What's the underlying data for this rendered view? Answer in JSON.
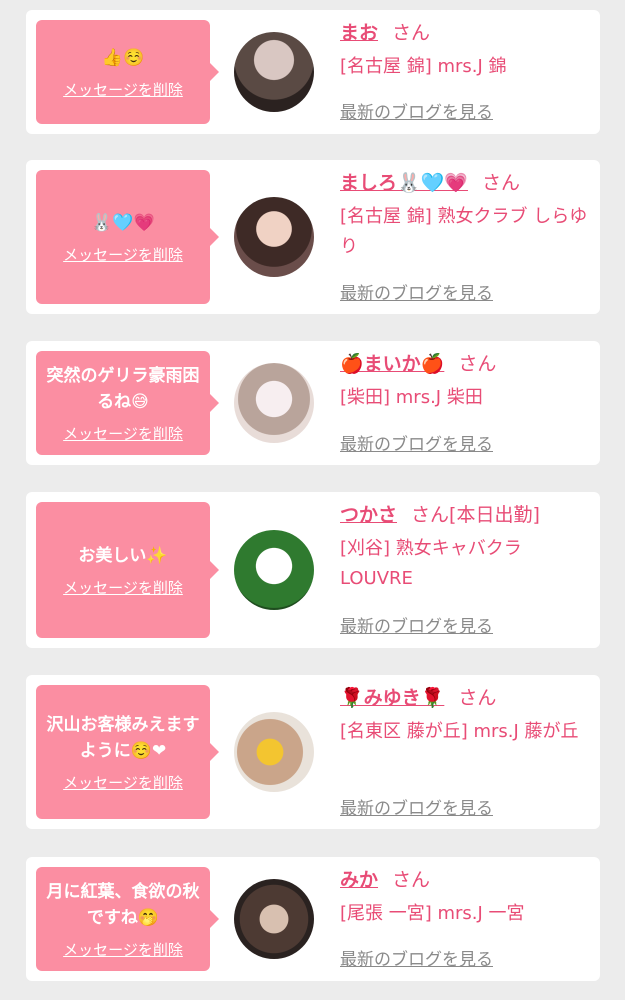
{
  "delete_label": "メッセージを削除",
  "blog_label": "最新のブログを見る",
  "san_label": "さん",
  "entries": [
    {
      "message": "👍☺️",
      "name": "まお",
      "status": "",
      "shop": "[名古屋 錦] mrs.J 錦"
    },
    {
      "message": "🐰🩵💗",
      "name": "ましろ🐰🩵💗",
      "status": "",
      "shop": "[名古屋 錦] 熟女クラブ しらゆり"
    },
    {
      "message": "突然のゲリラ豪雨困るね😅",
      "name": "🍎まいか🍎",
      "status": "",
      "shop": "[柴田] mrs.J 柴田"
    },
    {
      "message": "お美しい✨",
      "name": "つかさ",
      "status": "[本日出勤]",
      "shop": "[刈谷] 熟女キャバクラ LOUVRE"
    },
    {
      "message": "沢山お客様みえますように☺️❤",
      "name": "🌹みゆき🌹",
      "status": "",
      "shop": "[名東区 藤が丘] mrs.J 藤が丘"
    },
    {
      "message": "月に紅葉、食欲の秋ですね🤭",
      "name": "みか",
      "status": "",
      "shop": "[尾張 一宮] mrs.J 一宮"
    }
  ],
  "colors": {
    "background": "#ececec",
    "bubble": "#fb8ea2",
    "name": "#e84c76",
    "link": "#8a8a8a"
  }
}
